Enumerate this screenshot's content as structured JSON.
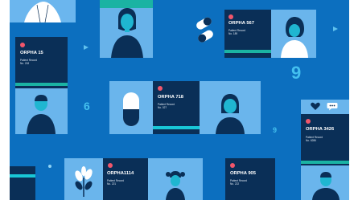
{
  "colors": {
    "background": "#0c6fbf",
    "tile": "#5aa9e6",
    "card": "#0a2f57",
    "accent_red": "#f2566b",
    "accent_teal": "#1bb3a3",
    "accent_cyan": "#19c7d6"
  },
  "cards": [
    {
      "code": "ORPHA 15",
      "line1": "Patient Record",
      "line2": "No. 218"
    },
    {
      "code": "ORPHA 567",
      "line1": "Patient Record",
      "line2": "No. 189"
    },
    {
      "code": "ORPHA 718",
      "line1": "Patient Record",
      "line2": "No. 027"
    },
    {
      "code": "ORPHA 3426",
      "line1": "Patient Record",
      "line2": "No. 6286"
    },
    {
      "code": "ORPHA1114",
      "line1": "Patient Record",
      "line2": "No. 221"
    },
    {
      "code": "ORPHA 905",
      "line1": "Patient Record",
      "line2": "No. 222"
    }
  ],
  "glyphs": {
    "nine_large": "9",
    "nine_small": "9",
    "six": "6"
  },
  "icons": [
    "heart-icon",
    "chat-bubble-icon",
    "pill-icon",
    "plant-icon",
    "pointer-arrow-icon"
  ]
}
